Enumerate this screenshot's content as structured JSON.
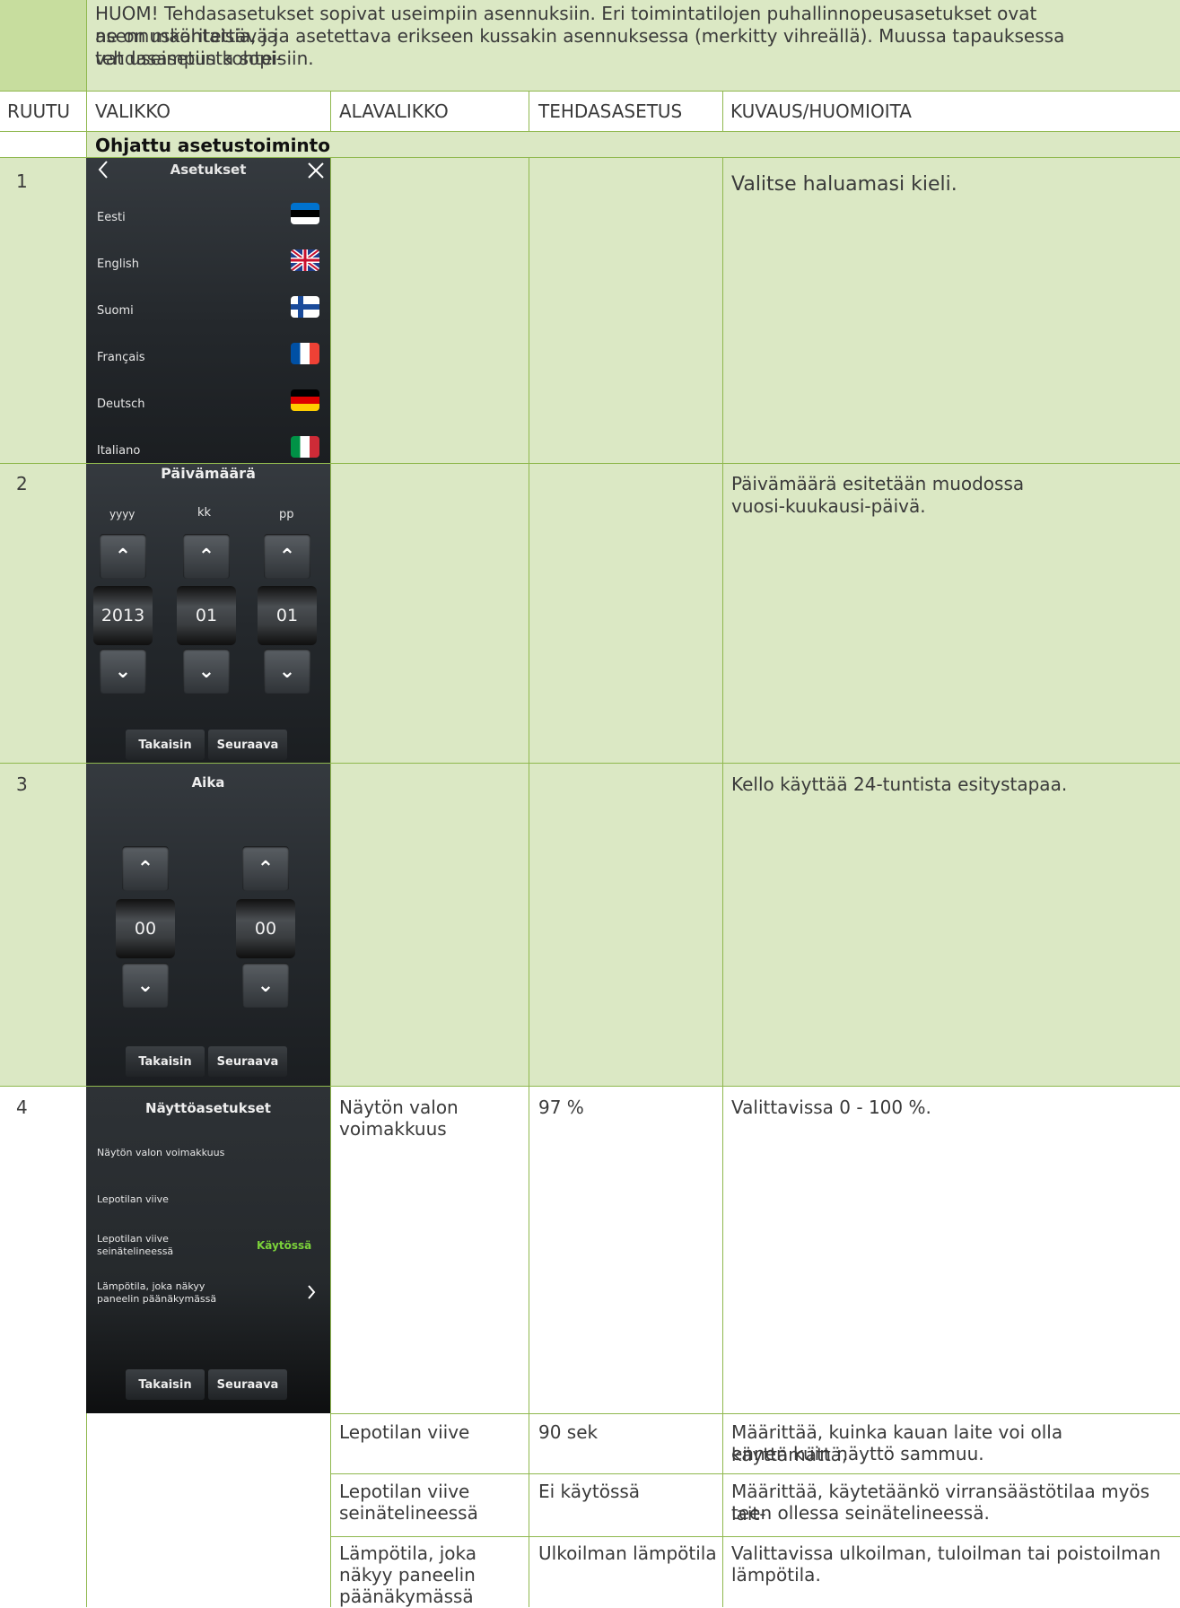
{
  "note": "HUOM! Tehdasasetukset sopivat useimpiin asennuksiin. Eri toimintatilojen puhallinnopeusasetukset ovat asennuskohtaisia, ja ne on määritettävä ja asetettava erikseen kussakin asennuksessa (merkitty vihreällä). Muussa tapauksessa tehdasasetusta sopivat useimpiin kohteisiin.",
  "note_lines": [
    "HUOM! Tehdasasetukset sopivat useimpiin asennuksiin. Eri toimintatilojen puhallinnopeusasetukset ovat asennuskohtaisia, ja",
    "ne on määritettävä ja asetettava erikseen kussakin asennuksessa (merkitty vihreällä). Muussa tapauksessa tehdasasetusta sopi-",
    "vat useimpiin kohteisiin."
  ],
  "headers": {
    "col1": "RUUTU",
    "col2": "VALIKKO",
    "col3": "ALAVALIKKO",
    "col4": "TEHDASASETUS",
    "col5": "KUVAUS/HUOMIOITA"
  },
  "section_title": "Ohjattu asetustoiminto",
  "rows": [
    {
      "num": "1",
      "desc": "Valitse haluamasi kieli."
    },
    {
      "num": "2",
      "desc_lines": [
        "Päivämäärä esitetään muodossa",
        "vuosi-kuukausi-päivä."
      ]
    },
    {
      "num": "3",
      "desc": "Kello käyttää 24-tuntista esitystapaa."
    },
    {
      "num": "4",
      "sub_lines": [
        "Näytön valon",
        "voimakkuus"
      ],
      "factory": "97 %",
      "desc": "Valittavissa 0 - 100 %."
    }
  ],
  "extra_rows": [
    {
      "sub": "Lepotilan viive",
      "factory": "90 sek",
      "desc_lines": [
        "Määrittää, kuinka kauan laite voi olla käyttämättä,",
        "ennen kuin näyttö sammuu."
      ]
    },
    {
      "sub_lines": [
        "Lepotilan viive",
        "seinätelineessä"
      ],
      "factory": "Ei käytössä",
      "desc_lines": [
        "Määrittää, käytetäänkö virransäästötilaa myös lait-",
        "teen ollessa seinätelineessä."
      ]
    },
    {
      "sub_lines": [
        "Lämpötila, joka",
        "näkyy paneelin",
        "päänäkymässä"
      ],
      "factory": "Ulkoilman lämpötila",
      "desc_lines": [
        "Valittavissa ulkoilman, tuloilman tai poistoilman",
        "lämpötila."
      ]
    }
  ],
  "screen1": {
    "title": "Asetukset",
    "back_icon": "chevron-left-icon",
    "close_icon": "close-icon",
    "languages": [
      {
        "label": "Eesti",
        "flag": "estonia-flag-icon"
      },
      {
        "label": "English",
        "flag": "uk-flag-icon"
      },
      {
        "label": "Suomi",
        "flag": "finland-flag-icon"
      },
      {
        "label": "Français",
        "flag": "france-flag-icon"
      },
      {
        "label": "Deutsch",
        "flag": "germany-flag-icon"
      },
      {
        "label": "Italiano",
        "flag": "italy-flag-icon"
      }
    ]
  },
  "screen2": {
    "title": "Päivämäärä",
    "labels": [
      "yyyy",
      "kk",
      "pp"
    ],
    "values": [
      "2013",
      "01",
      "01"
    ],
    "back": "Takaisin",
    "next": "Seuraava"
  },
  "screen3": {
    "title": "Aika",
    "values": [
      "00",
      "00"
    ],
    "back": "Takaisin",
    "next": "Seuraava"
  },
  "screen4": {
    "title": "Näyttöasetukset",
    "items": [
      "Näytön valon voimakkuus",
      "Lepotilan viive"
    ],
    "item3_lines": [
      "Lepotilan viive",
      "seinätelineessä"
    ],
    "item3_status": "Käytössä",
    "item4_lines": [
      "Lämpötila, joka näkyy",
      "paneelin päänäkymässä"
    ],
    "back": "Takaisin",
    "next": "Seuraava"
  },
  "colors": {
    "green_light": "#dbe8c4",
    "green_mid": "#c7dd9e",
    "rule": "#8fb84e",
    "status_green": "#7bd13a"
  }
}
